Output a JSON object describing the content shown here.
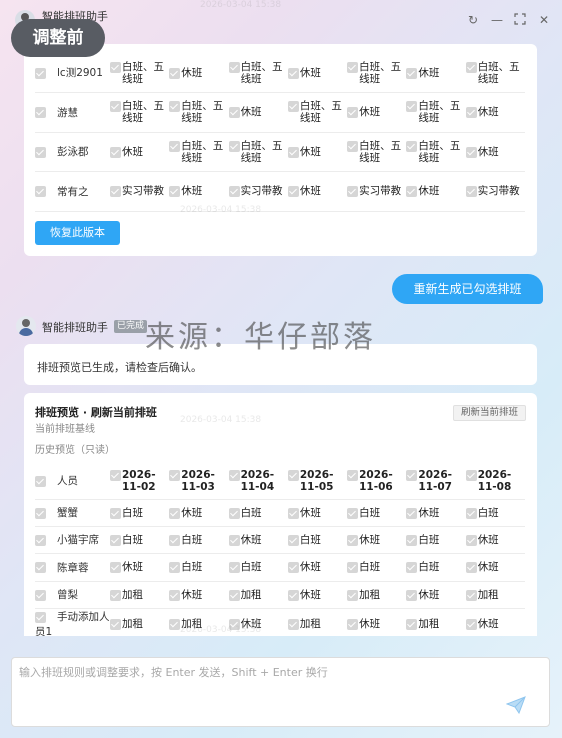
{
  "window": {
    "title": "智能排班助手"
  },
  "overlay_badge": "调整前",
  "top_table": {
    "rows": [
      {
        "name": "lc测2901",
        "cells": [
          "白班、五线班",
          "休班",
          "白班、五线班",
          "休班",
          "白班、五线班",
          "休班",
          "白班、五线班"
        ]
      },
      {
        "name": "游慧",
        "cells": [
          "白班、五线班",
          "白班、五线班",
          "休班",
          "白班、五线班",
          "休班",
          "白班、五线班",
          "休班"
        ]
      },
      {
        "name": "彭泳郡",
        "cells": [
          "休班",
          "白班、五线班",
          "白班、五线班",
          "休班",
          "白班、五线班",
          "白班、五线班",
          "休班"
        ]
      },
      {
        "name": "常有之",
        "cells": [
          "实习带教",
          "休班",
          "实习带教",
          "休班",
          "实习带教",
          "休班",
          "实习带教"
        ]
      }
    ],
    "restore_label": "恢复此版本"
  },
  "user_message": "重新生成已勾选排班",
  "bot": {
    "name": "智能排班助手",
    "status": "已完成"
  },
  "watermark": "来源：华仔部落",
  "preview_message": "排班预览已生成，请检查后确认。",
  "preview_card": {
    "title": "排班预览 · 刷新当前排班",
    "subtitle": "当前排班基线",
    "history": "历史预览（只读）",
    "refresh_label": "刷新当前排班",
    "header": {
      "person": "人员",
      "dates": [
        "2026-11-02",
        "2026-11-03",
        "2026-11-04",
        "2026-11-05",
        "2026-11-06",
        "2026-11-07",
        "2026-11-08"
      ]
    },
    "rows": [
      {
        "name": "蟹蟹",
        "cells": [
          "白班",
          "休班",
          "白班",
          "休班",
          "白班",
          "休班",
          "白班"
        ]
      },
      {
        "name": "小猫宇席",
        "cells": [
          "白班",
          "白班",
          "休班",
          "白班",
          "休班",
          "白班",
          "休班"
        ]
      },
      {
        "name": "陈章蓉",
        "cells": [
          "休班",
          "白班",
          "白班",
          "休班",
          "白班",
          "白班",
          "休班"
        ]
      },
      {
        "name": "曾梨",
        "cells": [
          "加租",
          "休班",
          "加租",
          "休班",
          "加租",
          "休班",
          "加租"
        ]
      },
      {
        "name": "手动添加人员1",
        "cells": [
          "加租",
          "加租",
          "休班",
          "加租",
          "休班",
          "加租",
          "休班"
        ]
      }
    ]
  },
  "input": {
    "placeholder": "输入排班规则或调整要求，按 Enter 发送，Shift + Enter 换行"
  },
  "icons": {
    "refresh": "refresh-icon",
    "minimize": "minimize-icon",
    "maximize": "maximize-icon",
    "close": "close-icon",
    "send": "send-icon"
  },
  "colors": {
    "accent": "#2fa6f5",
    "badge": "#585c63"
  }
}
